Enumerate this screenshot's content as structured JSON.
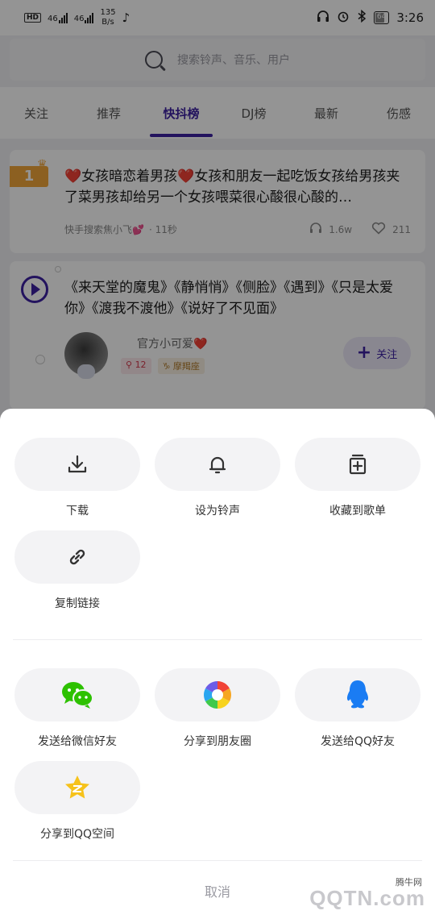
{
  "status_bar": {
    "hd": "HD",
    "sig1": "46",
    "sig2": "46",
    "speed_value": "135",
    "speed_unit": "B/s",
    "battery": "64",
    "time": "3:26"
  },
  "search": {
    "placeholder": "搜索铃声、音乐、用户"
  },
  "tabs": [
    {
      "label": "关注"
    },
    {
      "label": "推荐"
    },
    {
      "label": "快抖榜",
      "active": true
    },
    {
      "label": "DJ榜"
    },
    {
      "label": "最新"
    },
    {
      "label": "伤感"
    }
  ],
  "card1": {
    "rank": "1",
    "title": "❤️女孩暗恋着男孩❤️女孩和朋友一起吃饭女孩给男孩夹了菜男孩却给另一个女孩喂菜很心酸很心酸的…",
    "author": "快手搜索焦小飞💕",
    "time": "· 11秒",
    "plays": "1.6w",
    "likes": "211"
  },
  "card2": {
    "title": "《来天堂的魔鬼》《静悄悄》《侧脸》《遇到》《只是太爱你》《渡我不渡他》《说好了不见面》",
    "user": "官方小可爱❤️",
    "tag_count": "12",
    "tag_zodiac": "摩羯座",
    "follow_label": "关注"
  },
  "sheet": {
    "actions": [
      {
        "label": "下载",
        "icon": "download-icon"
      },
      {
        "label": "设为铃声",
        "icon": "bell-icon"
      },
      {
        "label": "收藏到歌单",
        "icon": "add-to-playlist-icon"
      },
      {
        "label": "复制链接",
        "icon": "link-icon"
      }
    ],
    "shares": [
      {
        "label": "发送给微信好友",
        "icon": "wechat-icon"
      },
      {
        "label": "分享到朋友圈",
        "icon": "moments-icon"
      },
      {
        "label": "发送给QQ好友",
        "icon": "qq-icon"
      },
      {
        "label": "分享到QQ空间",
        "icon": "qzone-icon"
      }
    ],
    "cancel": "取消"
  },
  "watermark": {
    "site": "腾牛网",
    "logo": "QQTN.com"
  },
  "colors": {
    "accent": "#3d21a3",
    "wechat": "#2dc100",
    "qq": "#1a7cf3",
    "qzone": "#f6c21b"
  }
}
